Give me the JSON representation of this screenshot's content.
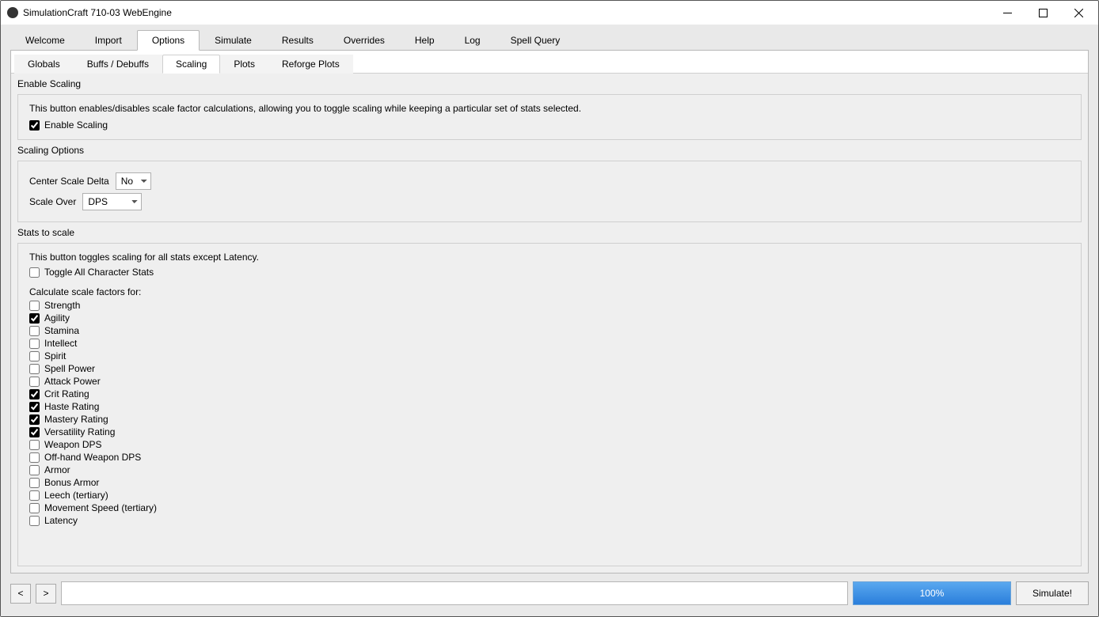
{
  "window": {
    "title": "SimulationCraft 710-03 WebEngine"
  },
  "tabs": {
    "main": [
      "Welcome",
      "Import",
      "Options",
      "Simulate",
      "Results",
      "Overrides",
      "Help",
      "Log",
      "Spell Query"
    ],
    "active_main": 2,
    "sub": [
      "Globals",
      "Buffs / Debuffs",
      "Scaling",
      "Plots",
      "Reforge Plots"
    ],
    "active_sub": 2
  },
  "enableScaling": {
    "group_label": "Enable Scaling",
    "desc": "This button enables/disables scale factor calculations, allowing you to toggle scaling while keeping a particular set of stats selected.",
    "checkbox_label": "Enable Scaling",
    "checked": true
  },
  "scalingOptions": {
    "group_label": "Scaling Options",
    "center_label": "Center Scale Delta",
    "center_value": "No",
    "scaleover_label": "Scale Over",
    "scaleover_value": "DPS"
  },
  "stats": {
    "group_label": "Stats to scale",
    "toggle_desc": "This button toggles scaling for all stats except Latency.",
    "toggle_label": "Toggle All Character Stats",
    "calc_label": "Calculate scale factors for:",
    "items": [
      {
        "label": "Strength",
        "checked": false
      },
      {
        "label": "Agility",
        "checked": true
      },
      {
        "label": "Stamina",
        "checked": false
      },
      {
        "label": "Intellect",
        "checked": false
      },
      {
        "label": "Spirit",
        "checked": false
      },
      {
        "label": "Spell Power",
        "checked": false
      },
      {
        "label": "Attack Power",
        "checked": false
      },
      {
        "label": "Crit Rating",
        "checked": true
      },
      {
        "label": "Haste Rating",
        "checked": true
      },
      {
        "label": "Mastery Rating",
        "checked": true
      },
      {
        "label": "Versatility Rating",
        "checked": true
      },
      {
        "label": "Weapon DPS",
        "checked": false
      },
      {
        "label": "Off-hand Weapon DPS",
        "checked": false
      },
      {
        "label": "Armor",
        "checked": false
      },
      {
        "label": "Bonus Armor",
        "checked": false
      },
      {
        "label": "Leech (tertiary)",
        "checked": false
      },
      {
        "label": "Movement Speed (tertiary)",
        "checked": false
      },
      {
        "label": "Latency",
        "checked": false
      }
    ]
  },
  "footer": {
    "back": "<",
    "fwd": ">",
    "progress": "100%",
    "simulate": "Simulate!"
  }
}
